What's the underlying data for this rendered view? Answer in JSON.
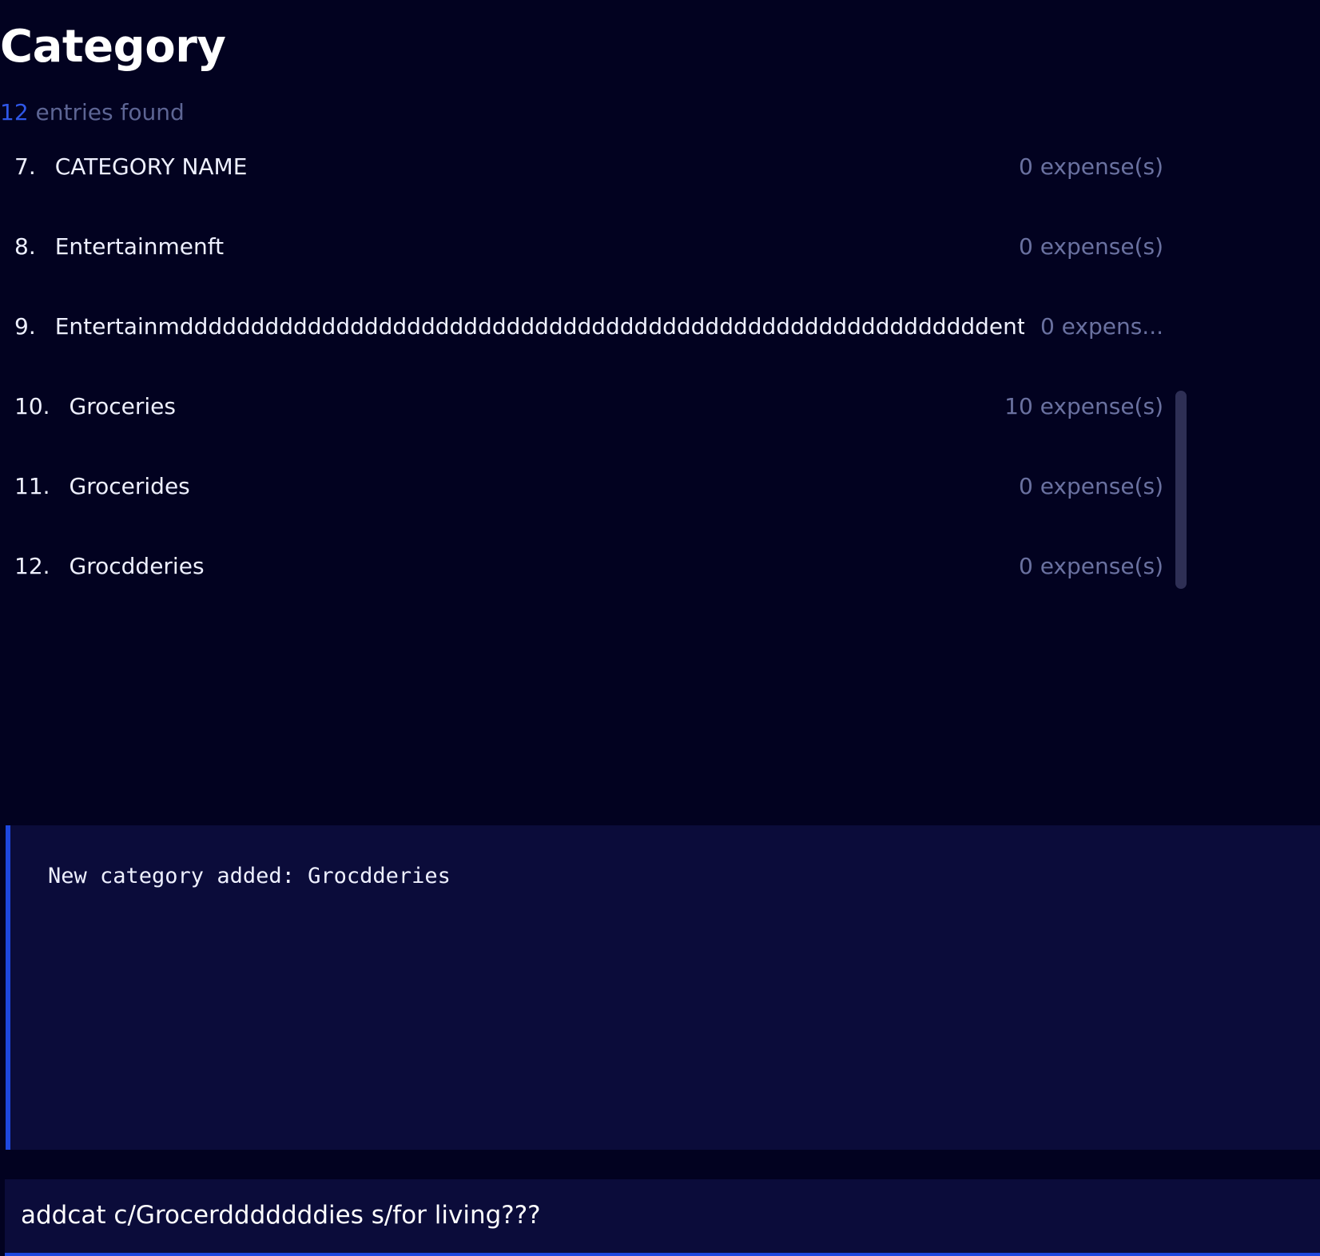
{
  "header": {
    "title": "Category"
  },
  "summary": {
    "count": "12",
    "suffix": " entries found"
  },
  "list": {
    "rows": [
      {
        "index": "7.",
        "name": "CATEGORY NAME",
        "count": "0 expense(s)"
      },
      {
        "index": "8.",
        "name": "Entertainmenft",
        "count": "0 expense(s)"
      },
      {
        "index": "9.",
        "name": "Entertainmdddddddddddddddddddddddddddddddddddddddddddddddddddddddddent",
        "count": "0  expens..."
      },
      {
        "index": "10.",
        "name": "Groceries",
        "count": "10 expense(s)"
      },
      {
        "index": "11.",
        "name": "Grocerides",
        "count": "0 expense(s)"
      },
      {
        "index": "12.",
        "name": "Grocdderies",
        "count": "0 expense(s)"
      }
    ]
  },
  "result": {
    "message": "New category added: Grocdderies"
  },
  "command": {
    "value": "addcat c/Grocerdddddddies s/for living???"
  },
  "colors": {
    "background": "#020220",
    "panel": "#0b0c3a",
    "accent": "#1e48e0",
    "muted_text": "#6a71a0"
  }
}
